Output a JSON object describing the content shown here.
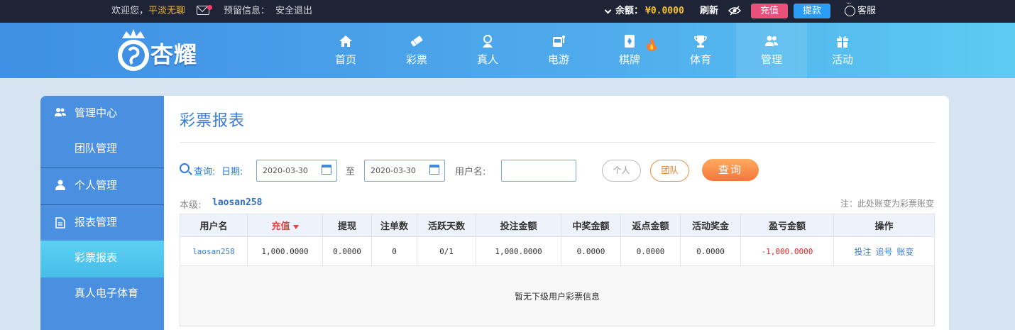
{
  "topbar": {
    "welcome": "欢迎您，",
    "nickname": "平淡无聊",
    "reserved_info": "预留信息：",
    "logout": "安全退出",
    "balance_label": "余额：",
    "balance_value": "¥0.0000",
    "refresh": "刷新",
    "recharge": "充值",
    "withdraw": "提款",
    "customer_service": "客服"
  },
  "brand": {
    "logo_text": "杏耀"
  },
  "nav": [
    {
      "label": "首页",
      "icon": "home-icon"
    },
    {
      "label": "彩票",
      "icon": "lottery-ticket-icon"
    },
    {
      "label": "真人",
      "icon": "live-dealer-icon"
    },
    {
      "label": "电游",
      "icon": "slot-machine-icon"
    },
    {
      "label": "棋牌",
      "icon": "card-game-icon"
    },
    {
      "label": "体育",
      "icon": "trophy-icon"
    },
    {
      "label": "管理",
      "icon": "users-icon",
      "active": true
    },
    {
      "label": "活动",
      "icon": "gift-icon"
    }
  ],
  "sidebar": {
    "items": [
      {
        "label": "管理中心",
        "icon": "users-icon"
      },
      {
        "label": "团队管理"
      },
      {
        "label": "个人管理",
        "icon": "user-icon"
      },
      {
        "label": "报表管理",
        "icon": "report-icon"
      },
      {
        "label": "彩票报表",
        "active": true
      },
      {
        "label": "真人电子体育"
      }
    ]
  },
  "page": {
    "title": "彩票报表",
    "query_label": "查询:",
    "date_label": "日期:",
    "date_from": "2020-03-30",
    "date_to": "2020-03-30",
    "to": "至",
    "username_label": "用户名:",
    "username_value": "",
    "personal": "个人",
    "team": "团队",
    "query_button": "查询",
    "level_label": "本级:",
    "level_user": "laosan258",
    "note": "注：此处账变为彩票账变"
  },
  "table": {
    "headers": [
      "用户名",
      "充值",
      "提现",
      "注单数",
      "活跃天数",
      "投注金额",
      "中奖金额",
      "返点金额",
      "活动奖金",
      "盈亏金额",
      "操作"
    ],
    "sorted_column": "充值",
    "rows": [
      {
        "username": "laosan258",
        "recharge": "1,000.0000",
        "withdraw": "0.0000",
        "orders": "0",
        "active_days": "0/1",
        "bet_amount": "1,000.0000",
        "win_amount": "0.0000",
        "rebate": "0.0000",
        "bonus": "0.0000",
        "profit": "-1,000.0000",
        "ops": [
          "投注",
          "追号",
          "账变"
        ]
      }
    ],
    "empty_message": "暂无下级用户彩票信息"
  },
  "colors": {
    "accent": "#3a7bd5",
    "topbar": "#1e2436",
    "recharge_btn": "#e8527a",
    "withdraw_btn": "#2b9df4",
    "query_btn": "#f5763c",
    "loss": "#e22222",
    "balance": "#f5c21b"
  }
}
